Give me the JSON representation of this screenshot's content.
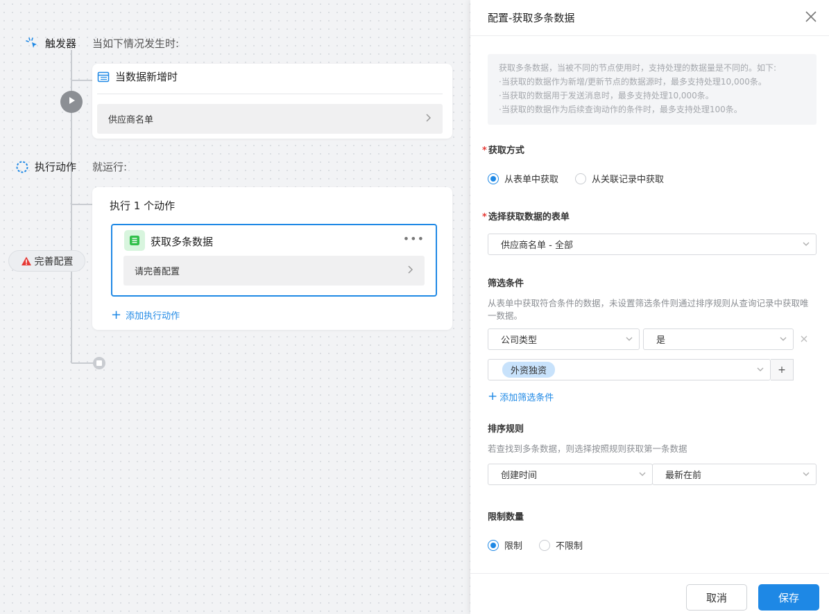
{
  "canvas": {
    "trigger": {
      "label": "触发器",
      "sub": "当如下情况发生时:"
    },
    "trigger_card": {
      "title": "当数据新增时",
      "source": "供应商名单"
    },
    "action_stage": {
      "label": "执行动作",
      "sub": "就运行:"
    },
    "action_card": {
      "count_text": "执行 1 个动作",
      "item_title": "获取多条数据",
      "item_hint": "请完善配置",
      "add_label": "添加执行动作"
    },
    "warning": {
      "label": "完善配置"
    }
  },
  "panel": {
    "title": "配置-获取多条数据",
    "info_lines": [
      "获取多条数据，当被不同的节点使用时，支持处理的数据量是不同的。如下:",
      "·当获取的数据作为新增/更新节点的数据源时，最多支持处理10,000条。",
      "·当获取的数据用于发送消息时，最多支持处理10,000条。",
      "·当获取的数据作为后续查询动作的条件时，最多支持处理100条。"
    ],
    "fetch_method": {
      "label": "获取方式",
      "options": [
        "从表单中获取",
        "从关联记录中获取"
      ],
      "selected": 0
    },
    "source_table": {
      "label": "选择获取数据的表单",
      "value": "供应商名单 - 全部"
    },
    "filter": {
      "label": "筛选条件",
      "desc": "从表单中获取符合条件的数据，未设置筛选条件则通过排序规则从查询记录中获取唯一数据。",
      "field": "公司类型",
      "operator": "是",
      "value_tag": "外资独资",
      "add_label": "添加筛选条件",
      "plus": "+"
    },
    "sort": {
      "label": "排序规则",
      "desc": "若查找到多条数据，则选择按照规则获取第一条数据",
      "field": "创建时间",
      "order": "最新在前"
    },
    "limit": {
      "label": "限制数量",
      "options": [
        "限制",
        "不限制"
      ],
      "selected": 0
    },
    "footer": {
      "cancel": "取消",
      "save": "保存"
    }
  },
  "colors": {
    "accent": "#1e88e5",
    "required": "#e53935",
    "warning": "#e53935",
    "success": "#31c04a"
  }
}
